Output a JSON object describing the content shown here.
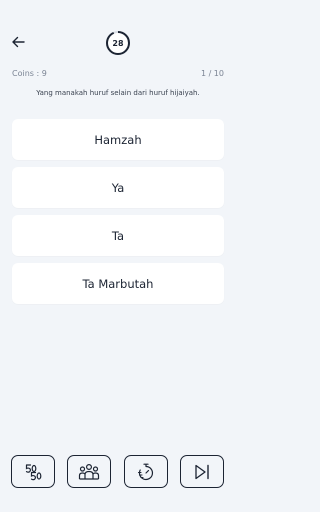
{
  "header": {
    "back_icon": "arrow-left-icon",
    "timer": {
      "value": "28",
      "progress": 0.93,
      "ring_color": "#1c2433",
      "track_color": "#d9dde4"
    }
  },
  "stats": {
    "coins_label": "Coins : 9",
    "progress_label": "1 / 10"
  },
  "question": {
    "text": "Yang manakah huruf selain dari huruf hijaiyah."
  },
  "options": [
    {
      "label": "Hamzah"
    },
    {
      "label": "Ya"
    },
    {
      "label": "Ta"
    },
    {
      "label": "Ta Marbutah"
    }
  ],
  "toolbar": {
    "items": [
      {
        "icon": "fifty-fifty-icon"
      },
      {
        "icon": "audience-icon"
      },
      {
        "icon": "timer-icon"
      },
      {
        "icon": "skip-next-icon"
      }
    ]
  },
  "colors": {
    "background": "#f2f5f9",
    "card": "#ffffff",
    "text": "#1c2433",
    "muted": "#7b8494"
  }
}
